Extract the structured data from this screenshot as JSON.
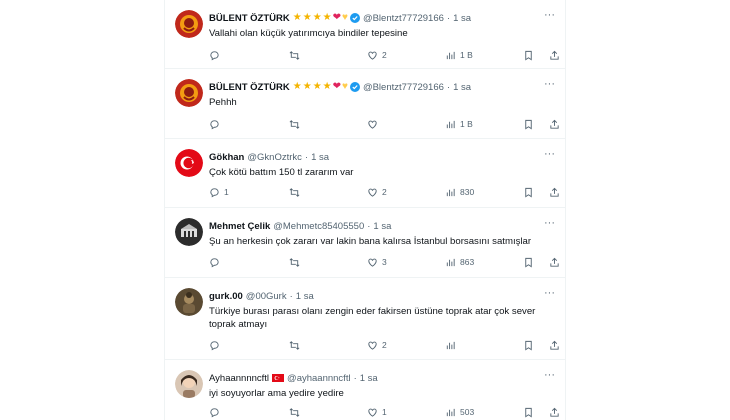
{
  "tweets": [
    {
      "name": "BÜLENT ÖZTÜRK",
      "name_emoji": [
        "★",
        "★",
        "★",
        "★",
        "❤",
        "♥"
      ],
      "verified": true,
      "handle": "@Blentzt77729166",
      "time": "1 sa",
      "text": "Vallahi olan küçük yatırımcıya bindiler tepesine",
      "replies": "",
      "retweets": "",
      "likes": "2",
      "views": "1 B"
    },
    {
      "name": "BÜLENT ÖZTÜRK",
      "name_emoji": [
        "★",
        "★",
        "★",
        "★",
        "❤",
        "♥"
      ],
      "verified": true,
      "handle": "@Blentzt77729166",
      "time": "1 sa",
      "text": "Pehhh",
      "replies": "",
      "retweets": "",
      "likes": "",
      "views": "1 B"
    },
    {
      "name": "Gökhan",
      "handle": "@GknOztrkc",
      "time": "1 sa",
      "text": "Çok kötü battım 150 tl zararım var",
      "replies": "1",
      "retweets": "",
      "likes": "2",
      "views": "830"
    },
    {
      "name": "Mehmet Çelik",
      "handle": "@Mehmetc85405550",
      "time": "1 sa",
      "text": "Şu an herkesin çok zararı var lakin bana kalırsa İstanbul borsasını satmışlar",
      "replies": "",
      "retweets": "",
      "likes": "3",
      "views": "863"
    },
    {
      "name": "gurk.00",
      "handle": "@00Gurk",
      "time": "1 sa",
      "text": "Türkiye burası parası olanı zengin eder fakirsen üstüne toprak atar çok sever toprak atmayı",
      "replies": "",
      "retweets": "",
      "likes": "2",
      "views": ""
    },
    {
      "name": "Ayhaannnncftl",
      "handle": "@ayhaannncftl",
      "time": "1 sa",
      "text": "iyi soyuyorlar ama yedire yedire",
      "replies": "",
      "retweets": "",
      "likes": "1",
      "views": "503"
    }
  ],
  "colors": {
    "text": "#0f1419",
    "secondary": "#536471",
    "verified": "#1d9bf0",
    "divider": "#eff3f4"
  },
  "icons": {
    "more": "more-horizontal-icon",
    "reply": "reply-icon",
    "retweet": "retweet-icon",
    "like": "heart-icon",
    "views": "views-icon",
    "bookmark": "bookmark-icon",
    "share": "share-icon"
  }
}
